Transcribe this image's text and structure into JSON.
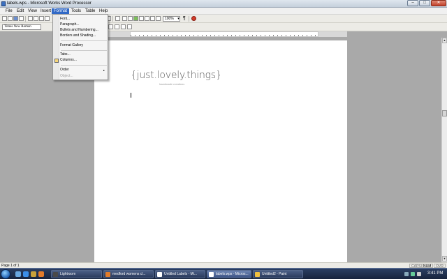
{
  "window": {
    "title": "labels.wps - Microsoft Works Word Processor",
    "minimize": "–",
    "maximize": "□",
    "close": "✕"
  },
  "menu": [
    "File",
    "Edit",
    "View",
    "Insert",
    "Format",
    "Tools",
    "Table",
    "Help"
  ],
  "active_menu": "Format",
  "format_menu": {
    "font": "Font...",
    "paragraph": "Paragraph...",
    "bullets": "Bullets and Numbering...",
    "borders": "Borders and Shading...",
    "gallery": "Format Gallery",
    "tabs": "Tabs...",
    "columns": "Columns...",
    "order": "Order",
    "object": "Object..."
  },
  "toolbar": {
    "font_name": "Times New Roman",
    "zoom": "100%",
    "zoom_arrow": "▾",
    "para_mark": "¶"
  },
  "document": {
    "logo_text": "{just.lovely.things}",
    "logo_sub": "handmade creations"
  },
  "scrollbar": {
    "up": "▲",
    "down": "▼"
  },
  "statusbar": {
    "page": "Page 1 of 1",
    "caps": "CAPS",
    "num": "NUM",
    "ovr": "OVR"
  },
  "taskbar": {
    "items": [
      "Lightroom",
      "medford womens cl...",
      "Untitled Labels - Mi...",
      "labels.wps - Micros...",
      "Untitled2 - Paint"
    ],
    "clock": "3:41 PM"
  },
  "colors": {
    "accent": "#3169c6",
    "taskbar": "#1f2f4f"
  }
}
